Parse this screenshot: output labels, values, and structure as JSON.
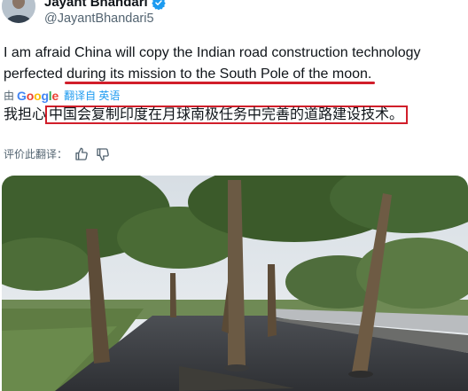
{
  "author": {
    "name": "Jayant Bhandari",
    "handle": "@JayantBhandari5",
    "verified": true
  },
  "tweet": {
    "line1": "I am afraid China will copy the Indian road construction technology",
    "line2_prefix": "perfected ",
    "line2_highlight": "during its mission to the South Pole of the moon."
  },
  "translation": {
    "by_label": "由",
    "google": [
      "G",
      "o",
      "o",
      "g",
      "l",
      "e"
    ],
    "translated_from_label": "翻译自 英语",
    "text_prefix": "我担心",
    "text_highlight": "中国会复制印度在月球南极任务中完善的道路建设技术。"
  },
  "rating": {
    "label": "评价此翻译：",
    "thumbs_up_icon": "thumbs-up-icon",
    "thumbs_down_icon": "thumbs-down-icon"
  },
  "colors": {
    "highlight": "#d11e2a",
    "link": "#1d9bf0",
    "verified": "#1d9bf0",
    "secondary_text": "#536471"
  }
}
